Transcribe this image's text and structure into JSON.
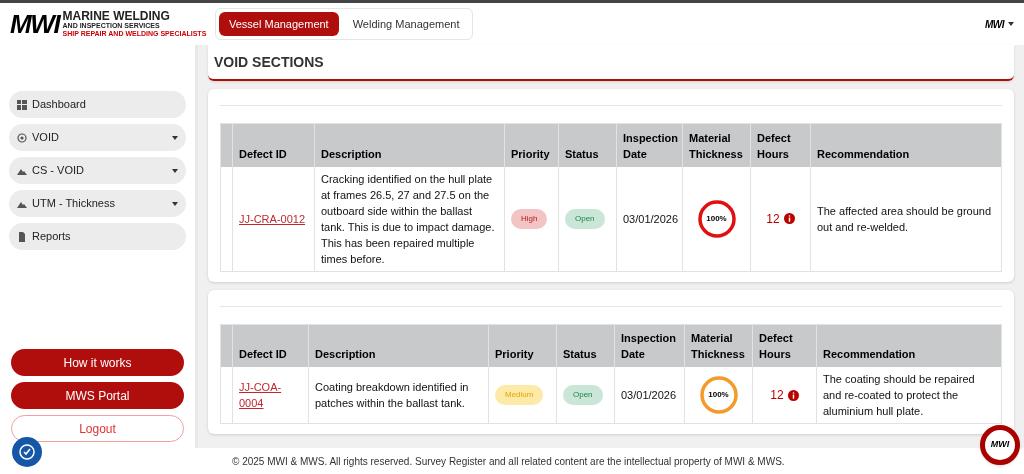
{
  "logo": {
    "mark": "MWI",
    "title": "MARINE WELDING",
    "subtitle": "AND INSPECTION SERVICES",
    "tagline": "SHIP REPAIR AND WELDING SPECIALISTS"
  },
  "tabs": [
    {
      "label": "Vessel Management",
      "selected": true
    },
    {
      "label": "Welding Management",
      "selected": false
    }
  ],
  "user_menu": {
    "mark": "MWI"
  },
  "sidebar": {
    "items": [
      {
        "label": "Dashboard",
        "kind": "grid",
        "expandable": false
      },
      {
        "label": "VOID",
        "kind": "target",
        "expandable": true
      },
      {
        "label": "CS - VOID",
        "kind": "mountain",
        "expandable": true
      },
      {
        "label": "UTM - Thickness",
        "kind": "mountain",
        "expandable": true
      },
      {
        "label": "Reports",
        "kind": "file",
        "expandable": false
      }
    ],
    "buttons": [
      {
        "label": "How it works",
        "kind": "solid"
      },
      {
        "label": "MWS Portal",
        "kind": "solid"
      },
      {
        "label": "Logout",
        "kind": "outline"
      }
    ]
  },
  "page_title": "VOID SECTIONS",
  "tables": [
    {
      "columns": [
        "Defect ID",
        "Description",
        "Priority",
        "Status",
        "Inspection Date",
        "Material Thickness",
        "Defect Hours",
        "Recommendation"
      ],
      "rows": [
        {
          "defect_id": "JJ-CRA-0012",
          "description": "Cracking identified on the hull plate at frames 26.5, 27 and 27.5 on the outboard side within the ballast tank. This is due to impact damage. This has been repaired multiple times before.",
          "priority": {
            "label": "High",
            "kind": "high"
          },
          "status": "Open",
          "inspection_date": "03/01/2026",
          "thickness": {
            "reading": "100%",
            "color": "#e01010"
          },
          "defect_hours": "12",
          "recommendation": "The affected area should be ground out and re-welded."
        }
      ]
    },
    {
      "columns": [
        "Defect ID",
        "Description",
        "Priority",
        "Status",
        "Inspection Date",
        "Material Thickness",
        "Defect Hours",
        "Recommendation"
      ],
      "rows": [
        {
          "defect_id": "JJ-COA-0004",
          "description": "Coating breakdown identified in patches within the ballast tank.",
          "priority": {
            "label": "Medium",
            "kind": "medium"
          },
          "status": "Open",
          "inspection_date": "03/01/2026",
          "thickness": {
            "reading": "100%",
            "color": "#f39a2b"
          },
          "defect_hours": "12",
          "recommendation": "The coating should be repaired and re-coated to protect the aluminium hull plate."
        }
      ]
    }
  ],
  "chat_button": {
    "mark": "MWI"
  },
  "footer": "© 2025 MWI & MWS. All rights reserved. Survey Register and all related content are the intellectual property of MWI & MWS."
}
